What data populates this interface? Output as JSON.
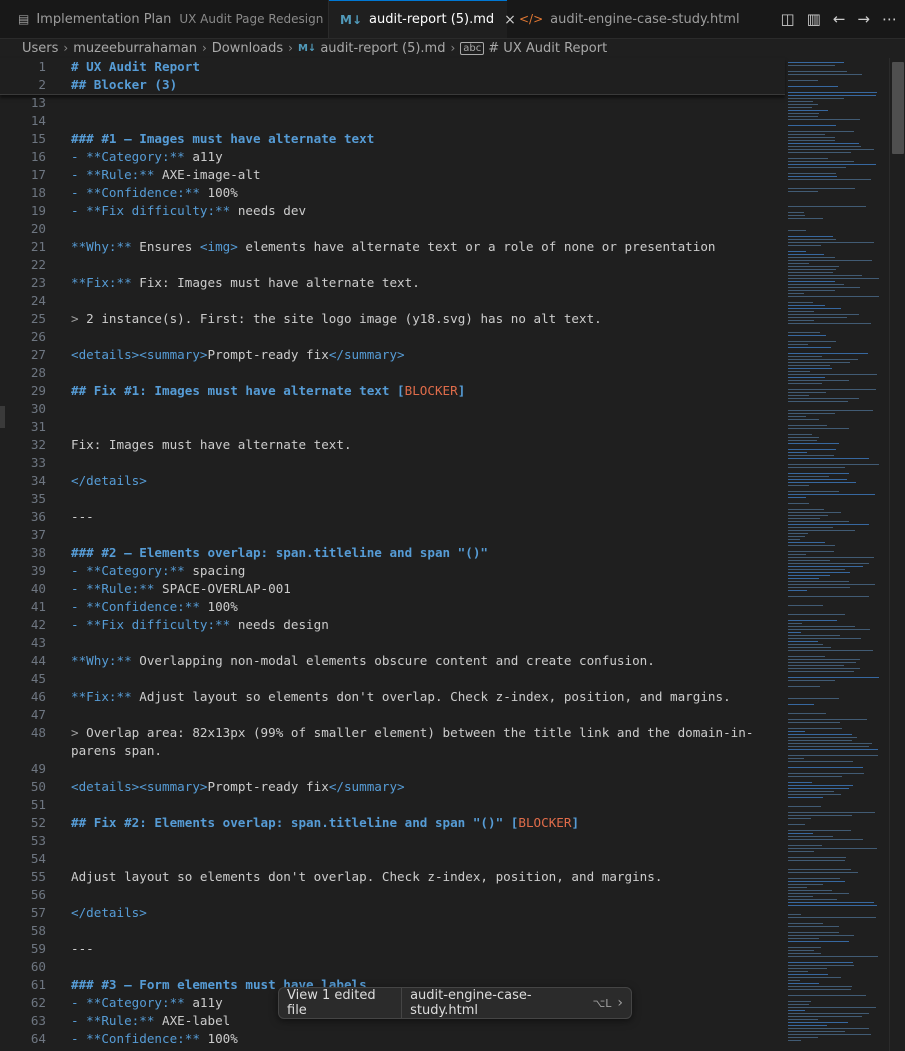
{
  "tabs": [
    {
      "icon": "document-icon",
      "label": "Implementation Plan",
      "sub": "UX Audit Page Redesign"
    },
    {
      "icon": "markdown-icon",
      "label": "audit-report (5).md",
      "active": true
    },
    {
      "icon": "html-icon",
      "label": "audit-engine-case-study.html"
    }
  ],
  "tab_icons": {
    "md": "M↓",
    "html": "</>",
    "close": "×"
  },
  "toolbar_icons": [
    "split-editor-icon",
    "layout-icon",
    "back-arrow-icon",
    "forward-arrow-icon",
    "more-icon"
  ],
  "breadcrumb": [
    "Users",
    "muzeeburrahaman",
    "Downloads",
    "audit-report (5).md",
    "# UX Audit Report"
  ],
  "sticky_lines": [
    {
      "n": "1",
      "text": "# UX Audit Report"
    },
    {
      "n": "2",
      "text": "## Blocker (3)"
    }
  ],
  "lines": [
    {
      "n": "13",
      "parts": []
    },
    {
      "n": "14",
      "parts": []
    },
    {
      "n": "15",
      "parts": [
        {
          "t": "### #1 — Images must have alternate text",
          "c": "c-head"
        }
      ]
    },
    {
      "n": "16",
      "parts": [
        {
          "t": "- **Category:**",
          "c": "c-bold"
        },
        {
          "t": " a11y"
        }
      ]
    },
    {
      "n": "17",
      "parts": [
        {
          "t": "- **Rule:**",
          "c": "c-bold"
        },
        {
          "t": " AXE-image-alt"
        }
      ]
    },
    {
      "n": "18",
      "parts": [
        {
          "t": "- **Confidence:**",
          "c": "c-bold"
        },
        {
          "t": " 100%"
        }
      ]
    },
    {
      "n": "19",
      "parts": [
        {
          "t": "- **Fix difficulty:**",
          "c": "c-bold"
        },
        {
          "t": " needs dev"
        }
      ]
    },
    {
      "n": "20",
      "parts": []
    },
    {
      "n": "21",
      "parts": [
        {
          "t": "**Why:**",
          "c": "c-bold"
        },
        {
          "t": " Ensures "
        },
        {
          "t": "<img>",
          "c": "c-tag"
        },
        {
          "t": " elements have alternate text or a role of none or presentation"
        }
      ]
    },
    {
      "n": "22",
      "parts": []
    },
    {
      "n": "23",
      "parts": [
        {
          "t": "**Fix:**",
          "c": "c-bold"
        },
        {
          "t": " Fix: Images must have alternate text."
        }
      ]
    },
    {
      "n": "24",
      "parts": []
    },
    {
      "n": "25",
      "parts": [
        {
          "t": "> ",
          "c": "c-dim"
        },
        {
          "t": "2 instance(s). First: the site logo image (y18.svg) has no alt text."
        }
      ]
    },
    {
      "n": "26",
      "parts": []
    },
    {
      "n": "27",
      "parts": [
        {
          "t": "<details><summary>",
          "c": "c-tag"
        },
        {
          "t": "Prompt-ready fix"
        },
        {
          "t": "</summary>",
          "c": "c-tag"
        }
      ]
    },
    {
      "n": "28",
      "parts": []
    },
    {
      "n": "29",
      "parts": [
        {
          "t": "## Fix #1: Images must have alternate text ",
          "c": "c-head"
        },
        {
          "t": "[",
          "c": "c-head"
        },
        {
          "t": "BLOCKER",
          "c": "c-red"
        },
        {
          "t": "]",
          "c": "c-head"
        }
      ]
    },
    {
      "n": "30",
      "parts": []
    },
    {
      "n": "31",
      "parts": []
    },
    {
      "n": "32",
      "parts": [
        {
          "t": "Fix: Images must have alternate text."
        }
      ]
    },
    {
      "n": "33",
      "parts": []
    },
    {
      "n": "34",
      "parts": [
        {
          "t": "</details>",
          "c": "c-tag"
        }
      ]
    },
    {
      "n": "35",
      "parts": []
    },
    {
      "n": "36",
      "parts": [
        {
          "t": "---"
        }
      ]
    },
    {
      "n": "37",
      "parts": []
    },
    {
      "n": "38",
      "parts": [
        {
          "t": "### #2 — Elements overlap: span.titleline and span \"()\"",
          "c": "c-head"
        }
      ]
    },
    {
      "n": "39",
      "parts": [
        {
          "t": "- **Category:**",
          "c": "c-bold"
        },
        {
          "t": " spacing"
        }
      ]
    },
    {
      "n": "40",
      "parts": [
        {
          "t": "- **Rule:**",
          "c": "c-bold"
        },
        {
          "t": " SPACE-OVERLAP-001"
        }
      ]
    },
    {
      "n": "41",
      "parts": [
        {
          "t": "- **Confidence:**",
          "c": "c-bold"
        },
        {
          "t": " 100%"
        }
      ]
    },
    {
      "n": "42",
      "parts": [
        {
          "t": "- **Fix difficulty:**",
          "c": "c-bold"
        },
        {
          "t": " needs design"
        }
      ]
    },
    {
      "n": "43",
      "parts": []
    },
    {
      "n": "44",
      "parts": [
        {
          "t": "**Why:**",
          "c": "c-bold"
        },
        {
          "t": " Overlapping non-modal elements obscure content and create confusion."
        }
      ]
    },
    {
      "n": "45",
      "parts": []
    },
    {
      "n": "46",
      "parts": [
        {
          "t": "**Fix:**",
          "c": "c-bold"
        },
        {
          "t": " Adjust layout so elements don't overlap. Check z-index, position, and margins."
        }
      ]
    },
    {
      "n": "47",
      "parts": []
    },
    {
      "n": "48",
      "wrap": true,
      "parts": [
        {
          "t": "> ",
          "c": "c-dim"
        },
        {
          "t": "Overlap area: 82x13px (99% of smaller element) between the title link and the domain-in-parens span."
        }
      ]
    },
    {
      "n": "49",
      "parts": []
    },
    {
      "n": "50",
      "parts": [
        {
          "t": "<details><summary>",
          "c": "c-tag"
        },
        {
          "t": "Prompt-ready fix"
        },
        {
          "t": "</summary>",
          "c": "c-tag"
        }
      ]
    },
    {
      "n": "51",
      "parts": []
    },
    {
      "n": "52",
      "parts": [
        {
          "t": "## Fix #2: Elements overlap: span.titleline and span \"()\" ",
          "c": "c-head"
        },
        {
          "t": "[",
          "c": "c-head"
        },
        {
          "t": "BLOCKER",
          "c": "c-red"
        },
        {
          "t": "]",
          "c": "c-head"
        }
      ]
    },
    {
      "n": "53",
      "parts": []
    },
    {
      "n": "54",
      "parts": []
    },
    {
      "n": "55",
      "parts": [
        {
          "t": "Adjust layout so elements don't overlap. Check z-index, position, and margins."
        }
      ]
    },
    {
      "n": "56",
      "parts": []
    },
    {
      "n": "57",
      "parts": [
        {
          "t": "</details>",
          "c": "c-tag"
        }
      ]
    },
    {
      "n": "58",
      "parts": []
    },
    {
      "n": "59",
      "parts": [
        {
          "t": "---"
        }
      ]
    },
    {
      "n": "60",
      "parts": []
    },
    {
      "n": "61",
      "parts": [
        {
          "t": "### #3 — Form elements must have labels",
          "c": "c-head"
        }
      ]
    },
    {
      "n": "62",
      "parts": [
        {
          "t": "- **Category:**",
          "c": "c-bold"
        },
        {
          "t": " a11y"
        }
      ]
    },
    {
      "n": "63",
      "parts": [
        {
          "t": "- **Rule:**",
          "c": "c-bold"
        },
        {
          "t": " AXE-label"
        }
      ]
    },
    {
      "n": "64",
      "parts": [
        {
          "t": "- **Confidence:**",
          "c": "c-bold"
        },
        {
          "t": " 100%"
        }
      ]
    }
  ],
  "popup": {
    "edited": "View 1 edited file",
    "file": "audit-engine-case-study.html",
    "shortcut": "⌥L",
    "chevron": "›"
  },
  "colors": {
    "accent": "#0078d4",
    "heading": "#569cd6",
    "badge": "#e06c4a",
    "background": "#1f1f1f"
  }
}
